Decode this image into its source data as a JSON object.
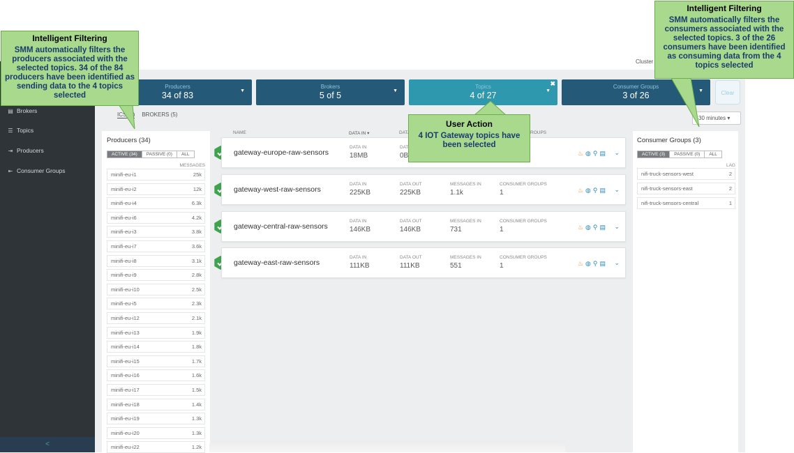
{
  "sidebar": {
    "items": [
      {
        "label": "Brokers",
        "icon": "server-icon"
      },
      {
        "label": "Topics",
        "icon": "list-icon"
      },
      {
        "label": "Producers",
        "icon": "producer-icon"
      },
      {
        "label": "Consumer Groups",
        "icon": "consumer-icon"
      }
    ],
    "collapse_glyph": "<"
  },
  "header": {
    "cluster_label": "Cluster"
  },
  "filters": [
    {
      "label": "Producers",
      "value": "34 of 83"
    },
    {
      "label": "Brokers",
      "value": "5 of 5"
    },
    {
      "label": "Topics",
      "value": "4 of 27"
    },
    {
      "label": "Consumer Groups",
      "value": "3 of 26"
    }
  ],
  "clear_label": "Clear",
  "tabs": {
    "topics": "ICS (4)",
    "brokers": "BROKERS (5)"
  },
  "time_select": "30 minutes",
  "producers_panel": {
    "title": "Producers (34)",
    "seg": [
      "ACTIVE (34)",
      "PASSIVE (0)",
      "ALL"
    ],
    "col": "MESSAGES",
    "rows": [
      {
        "name": "minifi-eu-i1",
        "val": "25k"
      },
      {
        "name": "minifi-eu-i2",
        "val": "12k"
      },
      {
        "name": "minifi-eu-i4",
        "val": "6.3k"
      },
      {
        "name": "minifi-eu-i6",
        "val": "4.2k"
      },
      {
        "name": "minifi-eu-i3",
        "val": "3.8k"
      },
      {
        "name": "minifi-eu-i7",
        "val": "3.6k"
      },
      {
        "name": "minifi-eu-i8",
        "val": "3.1k"
      },
      {
        "name": "minifi-eu-i9",
        "val": "2.8k"
      },
      {
        "name": "minifi-eu-i10",
        "val": "2.5k"
      },
      {
        "name": "minifi-eu-i5",
        "val": "2.3k"
      },
      {
        "name": "minifi-eu-i12",
        "val": "2.1k"
      },
      {
        "name": "minifi-eu-i13",
        "val": "1.9k"
      },
      {
        "name": "minifi-eu-i14",
        "val": "1.8k"
      },
      {
        "name": "minifi-eu-i15",
        "val": "1.7k"
      },
      {
        "name": "minifi-eu-i16",
        "val": "1.6k"
      },
      {
        "name": "minifi-eu-i17",
        "val": "1.5k"
      },
      {
        "name": "minifi-eu-i18",
        "val": "1.4k"
      },
      {
        "name": "minifi-eu-i19",
        "val": "1.3k"
      },
      {
        "name": "minifi-eu-i20",
        "val": "1.3k"
      },
      {
        "name": "minifi-eu-i22",
        "val": "1.2k"
      }
    ]
  },
  "topics_table": {
    "columns": {
      "name": "NAME",
      "data_in": "DATA IN ▾",
      "data_out": "DATA",
      "groups": "ROUPS"
    },
    "metric_labels": {
      "data_in": "DATA IN",
      "data_out": "DATA OUT",
      "messages_in": "MESSAGES IN",
      "consumer_groups": "CONSUMER GROUPS"
    },
    "rows": [
      {
        "name": "gateway-europe-raw-sensors",
        "data_in": "18MB",
        "data_out": "0B",
        "messages_in": "",
        "consumer_groups": ""
      },
      {
        "name": "gateway-west-raw-sensors",
        "data_in": "225KB",
        "data_out": "225KB",
        "messages_in": "1.1k",
        "consumer_groups": "1"
      },
      {
        "name": "gateway-central-raw-sensors",
        "data_in": "146KB",
        "data_out": "146KB",
        "messages_in": "731",
        "consumer_groups": "1"
      },
      {
        "name": "gateway-east-raw-sensors",
        "data_in": "111KB",
        "data_out": "111KB",
        "messages_in": "551",
        "consumer_groups": "1"
      }
    ]
  },
  "consumers_panel": {
    "title": "Consumer Groups (3)",
    "seg": [
      "ACTIVE (3)",
      "PASSIVE (0)",
      "ALL"
    ],
    "col": "LAG",
    "rows": [
      {
        "name": "nifi-truck-sensors-west",
        "val": "2"
      },
      {
        "name": "nifi-truck-sensors-east",
        "val": "2"
      },
      {
        "name": "nifi-truck-sensors-central",
        "val": "1"
      }
    ]
  },
  "callouts": {
    "left": {
      "title": "Intelligent Filtering",
      "body": "SMM automatically filters the producers associated with the selected topics. 34 of the 84 producers have been identified as sending data to the 4 topics selected"
    },
    "right": {
      "title": "Intelligent Filtering",
      "body": "SMM automatically filters the consumers associated with the selected topics. 3 of the 26 consumers have been identified as consuming data from the 4 topics selected"
    },
    "center": {
      "title": "User Action",
      "body": "4 IOT Gateway topics have been selected"
    }
  },
  "colors": {
    "filter_bg": "#245a78",
    "filter_selected": "#2e98ae",
    "callout_bg": "#a8d98c",
    "check_green": "#3fa34d"
  }
}
